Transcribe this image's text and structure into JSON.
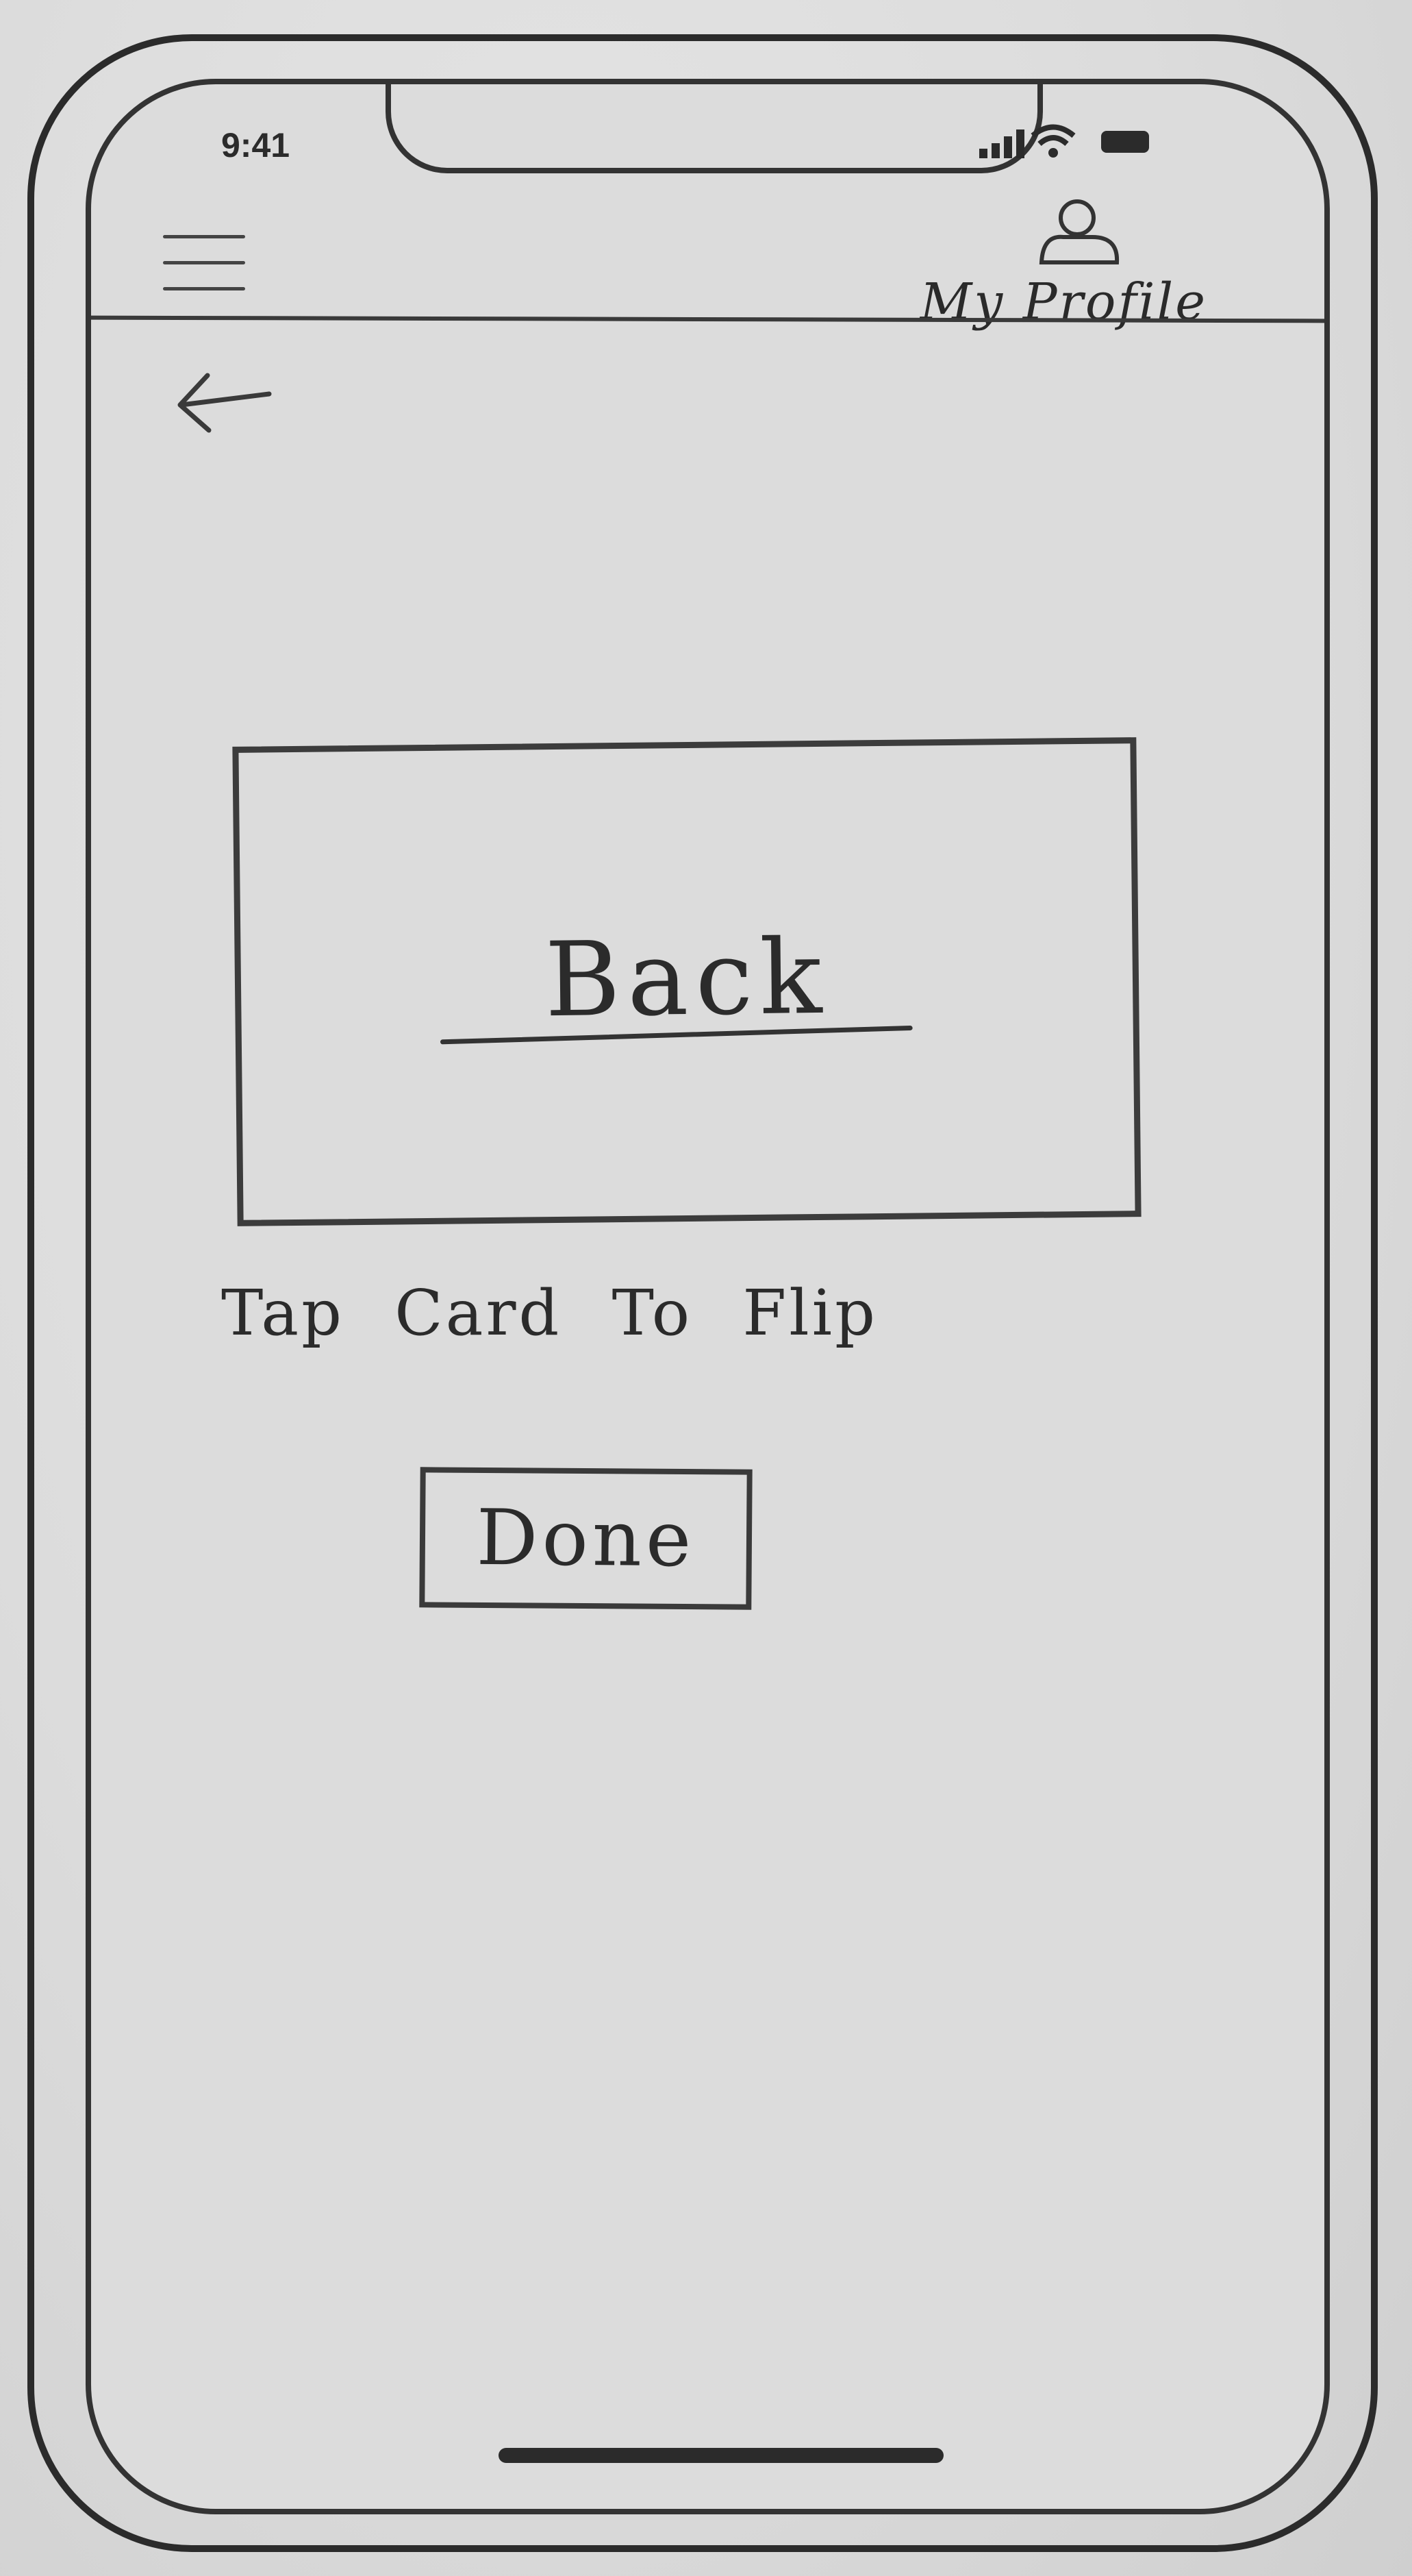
{
  "status_bar": {
    "time": "9:41"
  },
  "header": {
    "menu_icon": "hamburger-icon",
    "profile_icon": "person-icon",
    "profile_label": "My Profile"
  },
  "navigation": {
    "back_icon": "back-arrow-icon"
  },
  "card": {
    "text": "Back"
  },
  "hint_text": "Tap Card To Flip",
  "done_button_label": "Done"
}
